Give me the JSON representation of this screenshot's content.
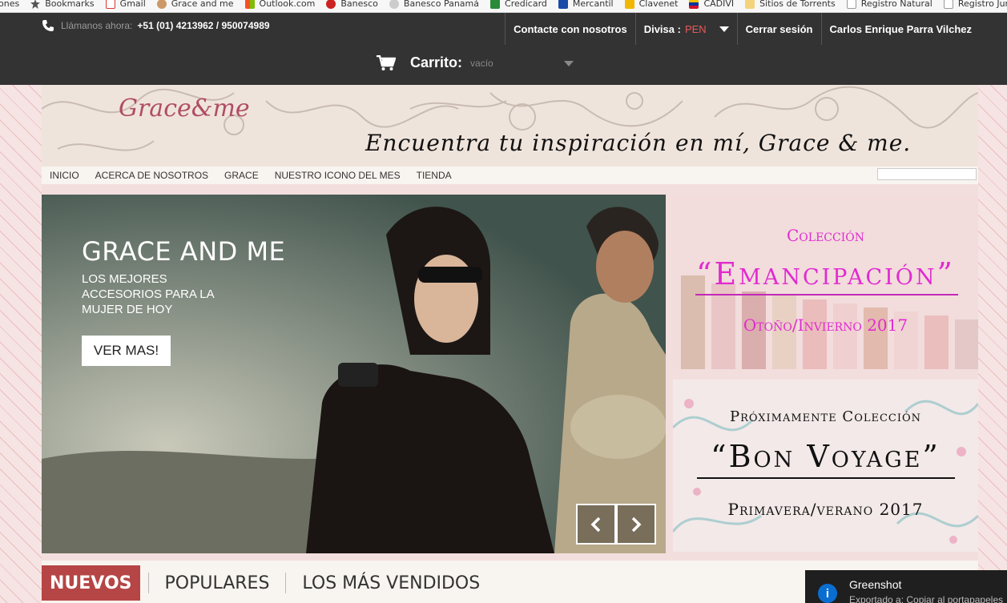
{
  "bookmarks": [
    {
      "label": "ones",
      "icon": "none"
    },
    {
      "label": "Bookmarks",
      "icon": "star-icon"
    },
    {
      "label": "Gmail",
      "icon": "gmail-icon"
    },
    {
      "label": "Grace and me",
      "icon": "grace-icon"
    },
    {
      "label": "Outlook.com",
      "icon": "windows-icon"
    },
    {
      "label": "Banesco",
      "icon": "banesco-icon"
    },
    {
      "label": "Banesco Panamá",
      "icon": "globe-icon"
    },
    {
      "label": "Credicard",
      "icon": "credicard-icon"
    },
    {
      "label": "Mercantil",
      "icon": "mercantil-icon"
    },
    {
      "label": "Clavenet",
      "icon": "clavenet-icon"
    },
    {
      "label": "CADIVI",
      "icon": "flag-icon"
    },
    {
      "label": "Sitios de Torrents",
      "icon": "folder-icon"
    },
    {
      "label": "Registro Natural",
      "icon": "page-icon"
    },
    {
      "label": "Registro Jurídico",
      "icon": "page-icon"
    }
  ],
  "topbar": {
    "phone_prefix": "Llámanos ahora:",
    "phone_number": "+51 (01) 4213962 / 950074989",
    "contact_label": "Contacte con nosotros",
    "currency_label": "Divisa :",
    "currency_value": "PEN",
    "logout_label": "Cerrar sesión",
    "user_name": "Carlos Enrique Parra Vilchez",
    "cart_label": "Carrito:",
    "cart_value": "vacío"
  },
  "banner": {
    "logo_text": "Grace&me",
    "tagline": "Encuentra tu inspiración en mí, Grace & me."
  },
  "nav": {
    "items": [
      "INICIO",
      "ACERCA DE NOSOTROS",
      "GRACE",
      "NUESTRO ICONO DEL MES",
      "TIENDA"
    ]
  },
  "hero": {
    "title": "GRACE AND ME",
    "subtitle": "LOS MEJORES ACCESORIOS PARA LA MUJER DE HOY",
    "button_label": "VER MAS!"
  },
  "promo1": {
    "line1": "Colección",
    "line2": "“Emancipación”",
    "line3": "Otoño/Invierno 2017"
  },
  "promo2": {
    "line1": "Próximamente Colección",
    "line2": "“Bon Voyage”",
    "line3": "Primavera/verano 2017"
  },
  "tabs": {
    "items": [
      "NUEVOS",
      "POPULARES",
      "LOS MÁS VENDIDOS"
    ]
  },
  "toast": {
    "title": "Greenshot",
    "text": "Exportado a: Copiar al portapapeles"
  },
  "colors": {
    "topbar": "#333333",
    "accent_red": "#b64545",
    "promo_magenta": "#e12ad0",
    "logo": "#b04d66"
  }
}
